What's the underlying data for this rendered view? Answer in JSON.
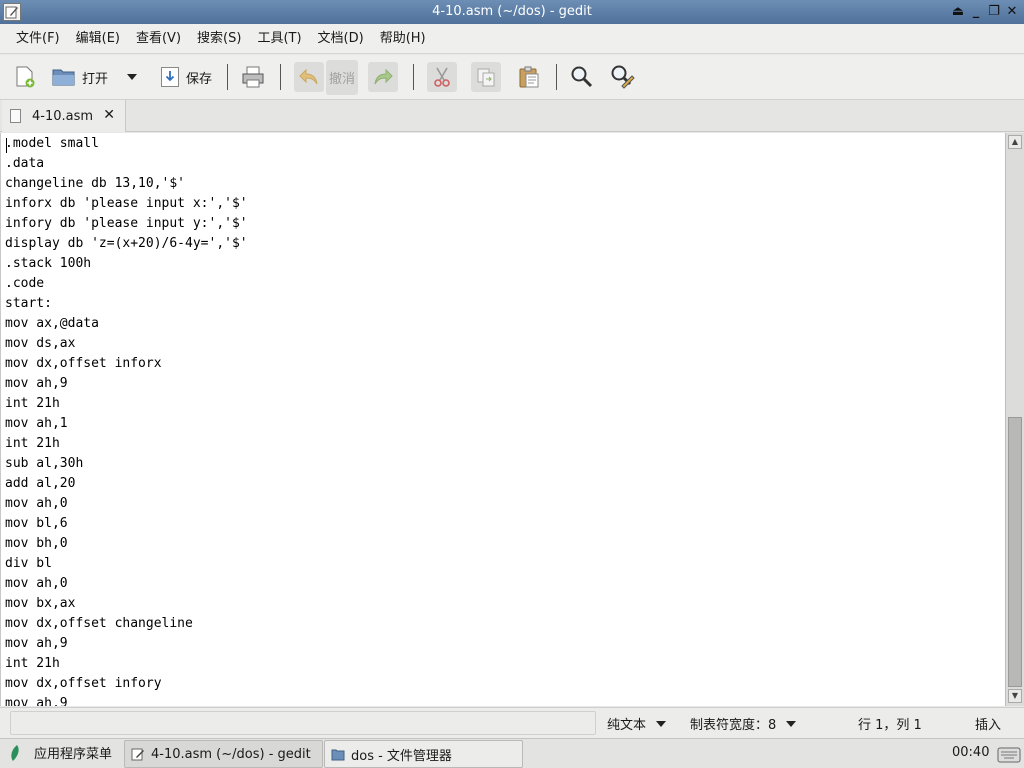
{
  "window": {
    "title": "4-10.asm (~/dos) - gedit"
  },
  "menu": {
    "items": [
      {
        "label": "文件(F)"
      },
      {
        "label": "编辑(E)"
      },
      {
        "label": "查看(V)"
      },
      {
        "label": "搜索(S)"
      },
      {
        "label": "工具(T)"
      },
      {
        "label": "文档(D)"
      },
      {
        "label": "帮助(H)"
      }
    ]
  },
  "toolbar": {
    "open_label": "打开",
    "save_label": "保存",
    "undo_label": "撤消"
  },
  "tab": {
    "label": "4-10.asm",
    "close": "✕"
  },
  "editor": {
    "lines": [
      ".model small",
      ".data",
      "changeline db 13,10,'$'",
      "inforx db 'please input x:','$'",
      "infory db 'please input y:','$'",
      "display db 'z=(x+20)/6-4y=','$'",
      ".stack 100h",
      ".code",
      "start:",
      "mov ax,@data",
      "mov ds,ax",
      "mov dx,offset inforx",
      "mov ah,9",
      "int 21h",
      "mov ah,1",
      "int 21h",
      "sub al,30h",
      "add al,20",
      "mov ah,0",
      "mov bl,6",
      "mov bh,0",
      "div bl",
      "mov ah,0",
      "mov bx,ax",
      "mov dx,offset changeline",
      "mov ah,9",
      "int 21h",
      "mov dx,offset infory",
      "mov ah,9"
    ]
  },
  "status": {
    "language": "纯文本",
    "tab_width": "制表符宽度：8",
    "position": "行 1，列 1",
    "mode": "插入"
  },
  "taskbar": {
    "app_menu": "应用程序菜单",
    "tasks": [
      {
        "label": "4-10.asm (~/dos) - gedit"
      },
      {
        "label": "dos - 文件管理器"
      }
    ],
    "clock": "00:40"
  }
}
